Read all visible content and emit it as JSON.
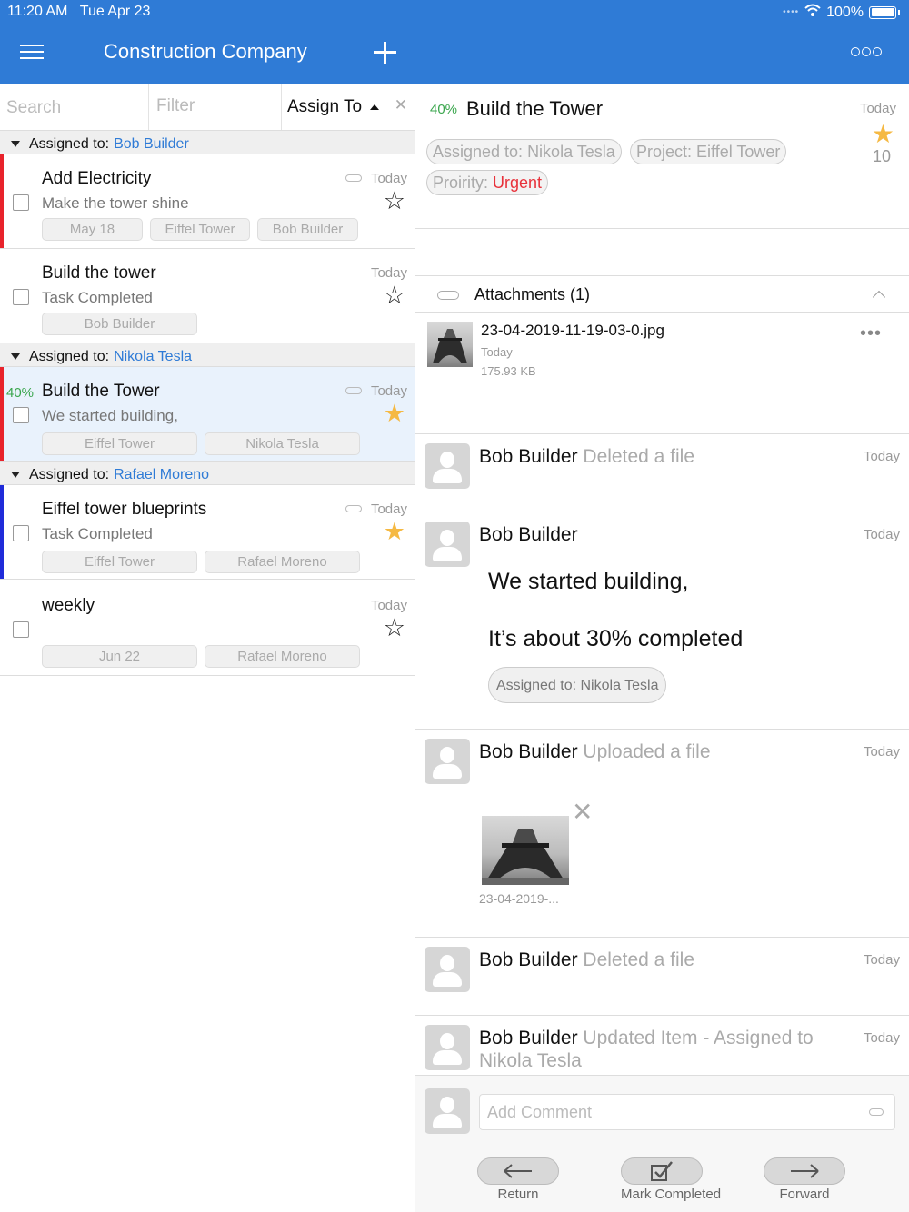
{
  "status_bar": {
    "time": "11:20 AM",
    "date": "Tue Apr 23",
    "battery": "100%"
  },
  "header": {
    "title": "Construction Company"
  },
  "search": {
    "search_placeholder": "Search",
    "filter_placeholder": "Filter",
    "sort_label": "Assign To"
  },
  "groups": [
    {
      "prefix": "Assigned to:",
      "name": "Bob Builder"
    },
    {
      "prefix": "Assigned to:",
      "name": "Nikola Tesla"
    },
    {
      "prefix": "Assigned to:",
      "name": "Rafael Moreno"
    }
  ],
  "tasks": [
    {
      "title": "Add Electricity",
      "subtitle": "Make the tower shine",
      "date": "Today",
      "tags": [
        "May 18",
        "Eiffel Tower",
        "Bob Builder"
      ],
      "starred": false,
      "flag_color": "#e8232b"
    },
    {
      "title": "Build the tower",
      "subtitle": "Task Completed",
      "date": "Today",
      "tags": [
        "Bob Builder"
      ],
      "starred": false
    },
    {
      "percent": "40%",
      "title": "Build the Tower",
      "subtitle": "We started building,",
      "date": "Today",
      "tags": [
        "Eiffel Tower",
        "Nikola Tesla"
      ],
      "starred": true,
      "flag_color": "#e8232b"
    },
    {
      "title": "Eiffel tower blueprints",
      "subtitle": "Task Completed",
      "date": "Today",
      "tags": [
        "Eiffel Tower",
        "Rafael Moreno"
      ],
      "starred": true,
      "flag_color": "#1f2bd9"
    },
    {
      "title": "weekly",
      "subtitle": "",
      "date": "Today",
      "tags": [
        "Jun 22",
        "Rafael Moreno"
      ],
      "starred": false
    }
  ],
  "detail": {
    "percent": "40%",
    "title": "Build the Tower",
    "date": "Today",
    "count": "10",
    "chips": {
      "assigned": "Assigned to: Nikola Tesla",
      "project": "Project: Eiffel Tower",
      "priority_label": "Proirity:",
      "priority_value": "Urgent"
    }
  },
  "attachments": {
    "header": "Attachments (1)",
    "files": [
      {
        "name": "23-04-2019-11-19-03-0.jpg",
        "date": "Today",
        "size": "175.93 KB"
      }
    ]
  },
  "activity": [
    {
      "user": "Bob Builder",
      "action": "Deleted a file",
      "date": "Today"
    },
    {
      "user": "Bob Builder",
      "action": "",
      "date": "Today",
      "comment_line1": "We started building,",
      "comment_line2": "It’s about 30% completed",
      "chip": "Assigned to:  Nikola Tesla"
    },
    {
      "user": "Bob Builder",
      "action": "Uploaded a file",
      "date": "Today",
      "file_caption": "23-04-2019-..."
    },
    {
      "user": "Bob Builder",
      "action": "Deleted a file",
      "date": "Today"
    },
    {
      "user": "Bob Builder",
      "action": "Updated Item - Assigned to Nikola Tesla",
      "date": "Today"
    }
  ],
  "composer": {
    "placeholder": "Add Comment"
  },
  "bottom_actions": {
    "return": "Return",
    "complete": "Mark Completed",
    "forward": "Forward"
  },
  "colors": {
    "brand": "#2f7bd6",
    "percent": "#3aa64d",
    "urgent": "#e8323b",
    "star": "#f5b943"
  }
}
